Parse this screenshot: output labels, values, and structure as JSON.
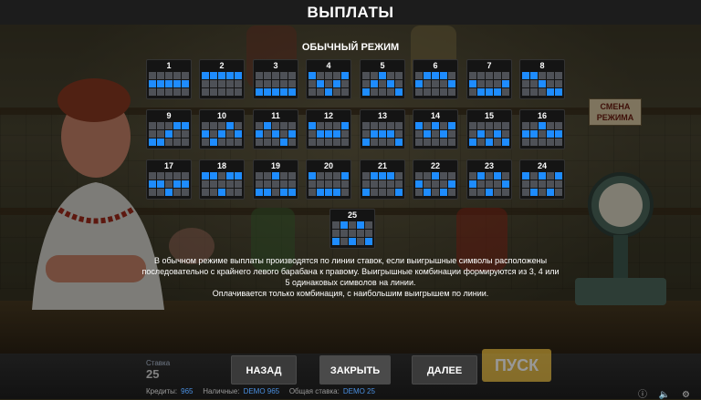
{
  "title": "ВЫПЛАТЫ",
  "mode_title": "ОБЫЧНЫЙ РЕЖИМ",
  "sign_text": "СМЕНА РЕЖИМА",
  "active_color": "#1e8cff",
  "inactive_color": "#4e5157",
  "lines": [
    {
      "num": "1",
      "rows": [
        1,
        1,
        1,
        1,
        1
      ]
    },
    {
      "num": "2",
      "rows": [
        0,
        0,
        0,
        0,
        0
      ]
    },
    {
      "num": "3",
      "rows": [
        2,
        2,
        2,
        2,
        2
      ]
    },
    {
      "num": "4",
      "rows": [
        0,
        1,
        2,
        1,
        0
      ]
    },
    {
      "num": "5",
      "rows": [
        2,
        1,
        0,
        1,
        2
      ]
    },
    {
      "num": "6",
      "rows": [
        1,
        0,
        0,
        0,
        1
      ]
    },
    {
      "num": "7",
      "rows": [
        1,
        2,
        2,
        2,
        1
      ]
    },
    {
      "num": "8",
      "rows": [
        0,
        0,
        1,
        2,
        2
      ]
    },
    {
      "num": "9",
      "rows": [
        2,
        2,
        1,
        0,
        0
      ]
    },
    {
      "num": "10",
      "rows": [
        1,
        2,
        1,
        0,
        1
      ]
    },
    {
      "num": "11",
      "rows": [
        1,
        0,
        1,
        2,
        1
      ]
    },
    {
      "num": "12",
      "rows": [
        0,
        1,
        1,
        1,
        0
      ]
    },
    {
      "num": "13",
      "rows": [
        2,
        1,
        1,
        1,
        2
      ]
    },
    {
      "num": "14",
      "rows": [
        0,
        1,
        0,
        1,
        0
      ]
    },
    {
      "num": "15",
      "rows": [
        2,
        1,
        2,
        1,
        2
      ]
    },
    {
      "num": "16",
      "rows": [
        1,
        1,
        0,
        1,
        1
      ]
    },
    {
      "num": "17",
      "rows": [
        1,
        1,
        2,
        1,
        1
      ]
    },
    {
      "num": "18",
      "rows": [
        0,
        0,
        2,
        0,
        0
      ]
    },
    {
      "num": "19",
      "rows": [
        2,
        2,
        0,
        2,
        2
      ]
    },
    {
      "num": "20",
      "rows": [
        0,
        2,
        2,
        2,
        0
      ]
    },
    {
      "num": "21",
      "rows": [
        2,
        0,
        0,
        0,
        2
      ]
    },
    {
      "num": "22",
      "rows": [
        1,
        2,
        0,
        2,
        1
      ]
    },
    {
      "num": "23",
      "rows": [
        1,
        0,
        2,
        0,
        1
      ]
    },
    {
      "num": "24",
      "rows": [
        0,
        2,
        0,
        2,
        0
      ]
    },
    {
      "num": "25",
      "rows": [
        2,
        0,
        2,
        0,
        2
      ]
    }
  ],
  "description": [
    "В обычном режиме выплаты производятся по линии ставок, если выигрышные символы расположены",
    "последовательно с крайнего левого барабана к правому. Выигрышные комбинации формируются из 3, 4 или",
    "5 одинаковых символов на линии.",
    "Оплачивается только комбинация, с наибольшим выигрышем по линии."
  ],
  "buttons": {
    "back": "НАЗАД",
    "close": "ЗАКРЫТЬ",
    "next": "ДАЛЕЕ"
  },
  "spin_label": "ПУСК",
  "stake": {
    "label": "Ставка",
    "value": "25"
  },
  "status": {
    "credits_label": "Кредиты:",
    "credits_value": "965",
    "cash_label": "Наличные:",
    "cash_value": "DEMO 965",
    "total_bet_label": "Общая ставка:",
    "total_bet_value": "DEMO 25"
  }
}
